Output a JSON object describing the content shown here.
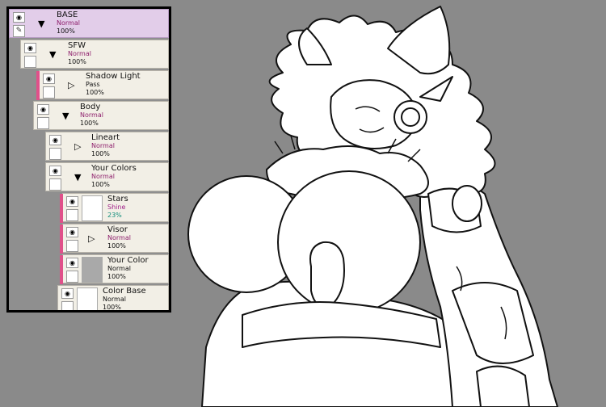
{
  "colors": {
    "background": "#8a8a8a",
    "panel_bg": "#8f8f8f",
    "layer_bg": "#f2efe6",
    "selected_layer_bg": "#e2cde9",
    "blend_mode_text": "#8e1f6c",
    "clipping_marker": "#e0508a",
    "opacity_accent": "#0f8d7a"
  },
  "layers": [
    {
      "name": "BASE",
      "blend": "Normal",
      "opacity": "100%",
      "type": "folder",
      "expanded": true,
      "selected": true
    },
    {
      "name": "SFW",
      "blend": "Normal",
      "opacity": "100%",
      "type": "folder",
      "expanded": true
    },
    {
      "name": "Shadow Light",
      "blend": "Pass",
      "opacity": "100%",
      "type": "folder",
      "expanded": false
    },
    {
      "name": "Body",
      "blend": "Normal",
      "opacity": "100%",
      "type": "folder",
      "expanded": true
    },
    {
      "name": "Lineart",
      "blend": "Normal",
      "opacity": "100%",
      "type": "folder",
      "expanded": false
    },
    {
      "name": "Your Colors",
      "blend": "Normal",
      "opacity": "100%",
      "type": "folder",
      "expanded": true
    },
    {
      "name": "Stars",
      "blend": "Shine",
      "opacity": "23%",
      "type": "layer",
      "thumbnail": "white"
    },
    {
      "name": "Visor",
      "blend": "Normal",
      "opacity": "100%",
      "type": "folder",
      "expanded": false
    },
    {
      "name": "Your Color",
      "blend": "Normal",
      "opacity": "100%",
      "type": "layer",
      "thumbnail": "gray"
    },
    {
      "name": "Color Base",
      "blend": "Normal",
      "opacity": "100%",
      "type": "layer",
      "thumbnail": "white"
    }
  ],
  "icons": {
    "eye": "eye-icon",
    "pencil": "pencil-icon",
    "expanded": "triangle-down-icon",
    "collapsed": "triangle-right-icon"
  },
  "canvas": {
    "description_style": "black line art sketch on grey background"
  }
}
